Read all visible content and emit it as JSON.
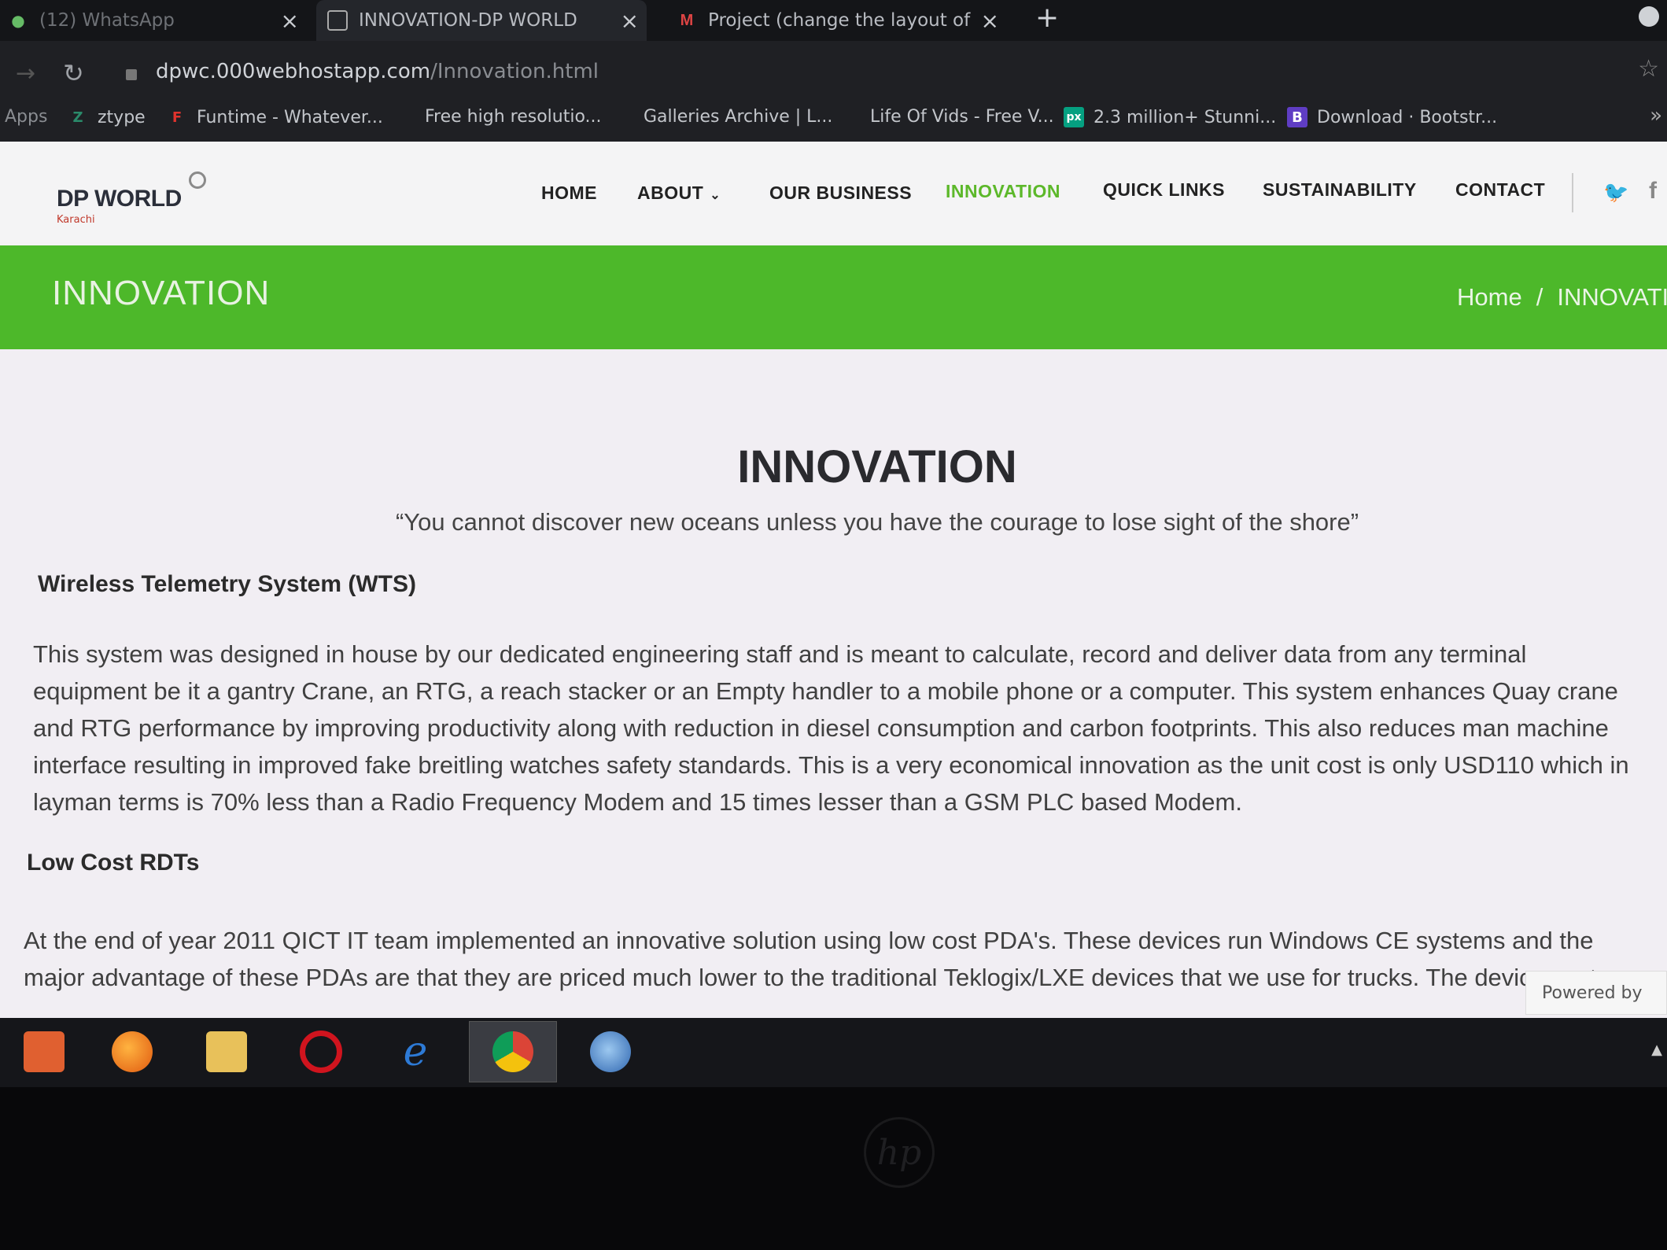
{
  "browser": {
    "tabs": [
      {
        "title": "(12) WhatsApp",
        "icon": "whatsapp-icon"
      },
      {
        "title": "INNOVATION-DP WORLD",
        "icon": "site-icon"
      },
      {
        "title": "Project (change the layout of e",
        "icon": "gmail-icon"
      }
    ],
    "close_glyph": "×",
    "new_tab_glyph": "+",
    "address": {
      "domain": "dpwc.000webhostapp.com",
      "path": "/Innovation.html"
    },
    "bookmarks": [
      {
        "label": "Apps"
      },
      {
        "label": "ztype",
        "icon": "ztype-icon"
      },
      {
        "label": "Funtime - Whatever...",
        "icon": "funtime-icon",
        "icon_glyph": "F",
        "icon_color": "#e0332d"
      },
      {
        "label": "Free high resolutio..."
      },
      {
        "label": "Galleries Archive | L..."
      },
      {
        "label": "Life Of Vids - Free V..."
      },
      {
        "label": "2.3 million+ Stunni...",
        "icon": "pexels-icon",
        "icon_glyph": "px",
        "icon_color": "#05a081"
      },
      {
        "label": "Download · Bootstr...",
        "icon": "bootstrap-icon",
        "icon_glyph": "B",
        "icon_color": "#5f3dc4"
      }
    ],
    "more_glyph": "»"
  },
  "site": {
    "logo_text": "DP WORLD",
    "logo_sub": "Karachi",
    "nav": {
      "home": "HOME",
      "about": "ABOUT",
      "business": "OUR BUSINESS",
      "innovation": "INNOVATION",
      "quick_links": "QUICK LINKS",
      "sustainability": "SUSTAINABILITY",
      "contact": "CONTACT"
    },
    "social": {
      "twitter_glyph": "🐦",
      "facebook_glyph": "f"
    },
    "colors": {
      "accent": "#4db82a",
      "nav_active": "#5cb82a"
    }
  },
  "banner": {
    "title": "INNOVATION",
    "breadcrumb_home": "Home",
    "breadcrumb_sep": "/",
    "breadcrumb_current": "INNOVATION"
  },
  "content": {
    "title": "INNOVATION",
    "quote": "“You cannot discover new oceans unless you have the courage to lose sight of the shore”",
    "sections": [
      {
        "heading": "Wireless Telemetry System (WTS)",
        "lines": [
          "This system was designed in house by our dedicated engineering staff and is meant to calculate, record and deliver data from any terminal",
          "equipment be it a gantry Crane, an RTG, a reach stacker or an Empty handler to a mobile phone or a computer. This system enhances Quay crane",
          "and RTG performance by improving productivity along with reduction in diesel consumption and carbon footprints. This also reduces man machine",
          "interface resulting in improved fake breitling watches safety standards. This is a very economical innovation as the unit cost is only USD110 which in",
          "layman terms is 70% less than a Radio Frequency Modem and 15 times lesser than a GSM PLC based Modem."
        ]
      },
      {
        "heading": "Low Cost RDTs",
        "lines": [
          "At the end of year 2011 QICT IT team implemented an innovative solution using low cost PDA's. These devices run Windows CE systems and the",
          "major advantage of these PDAs are that they are priced much lower to the traditional Teklogix/LXE devices that we use for trucks. The device costs"
        ]
      }
    ],
    "powered_by": "Powered by"
  },
  "taskbar": {
    "apps": [
      {
        "name": "media-player-icon",
        "color": "#e06030"
      },
      {
        "name": "firefox-icon",
        "color": "#f07a1a"
      },
      {
        "name": "file-explorer-icon",
        "color": "#e8c15a"
      },
      {
        "name": "opera-icon",
        "color": "#d0141e"
      },
      {
        "name": "internet-explorer-icon",
        "color": "#2d7ad6"
      },
      {
        "name": "chrome-icon",
        "color": "#3aa24a"
      },
      {
        "name": "network-icon",
        "color": "#3f7fc8"
      }
    ],
    "tray_glyph": "▲"
  },
  "bezel": {
    "brand": "hp"
  }
}
